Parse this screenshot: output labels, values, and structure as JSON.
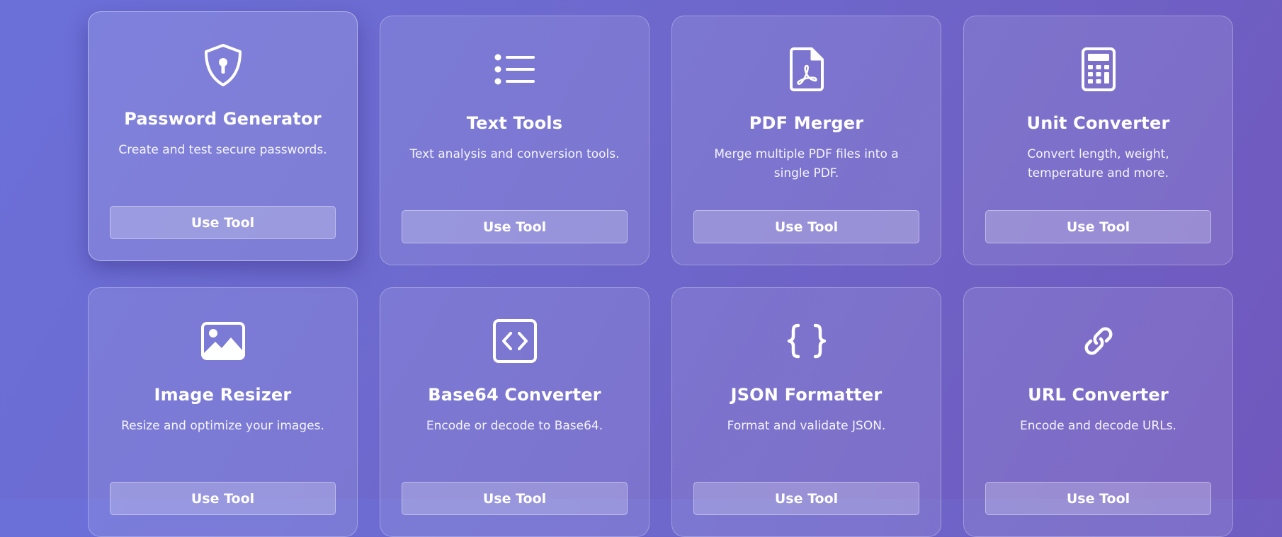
{
  "tools": [
    {
      "title": "Password Generator",
      "description": "Create and test secure passwords.",
      "button": "Use Tool",
      "icon": "shield-keyhole-icon"
    },
    {
      "title": "Text Tools",
      "description": "Text analysis and conversion tools.",
      "button": "Use Tool",
      "icon": "list-icon"
    },
    {
      "title": "PDF Merger",
      "description": "Merge multiple PDF files into a single PDF.",
      "button": "Use Tool",
      "icon": "pdf-file-icon"
    },
    {
      "title": "Unit Converter",
      "description": "Convert length, weight, temperature and more.",
      "button": "Use Tool",
      "icon": "calculator-icon"
    },
    {
      "title": "Image Resizer",
      "description": "Resize and optimize your images.",
      "button": "Use Tool",
      "icon": "image-icon"
    },
    {
      "title": "Base64 Converter",
      "description": "Encode or decode to Base64.",
      "button": "Use Tool",
      "icon": "code-square-icon"
    },
    {
      "title": "JSON Formatter",
      "description": "Format and validate JSON.",
      "button": "Use Tool",
      "icon": "braces-icon"
    },
    {
      "title": "URL Converter",
      "description": "Encode and decode URLs.",
      "button": "Use Tool",
      "icon": "link-icon"
    }
  ],
  "colors": {
    "background_start": "#6b70d9",
    "background_end": "#7058bd",
    "text": "#ffffff"
  }
}
